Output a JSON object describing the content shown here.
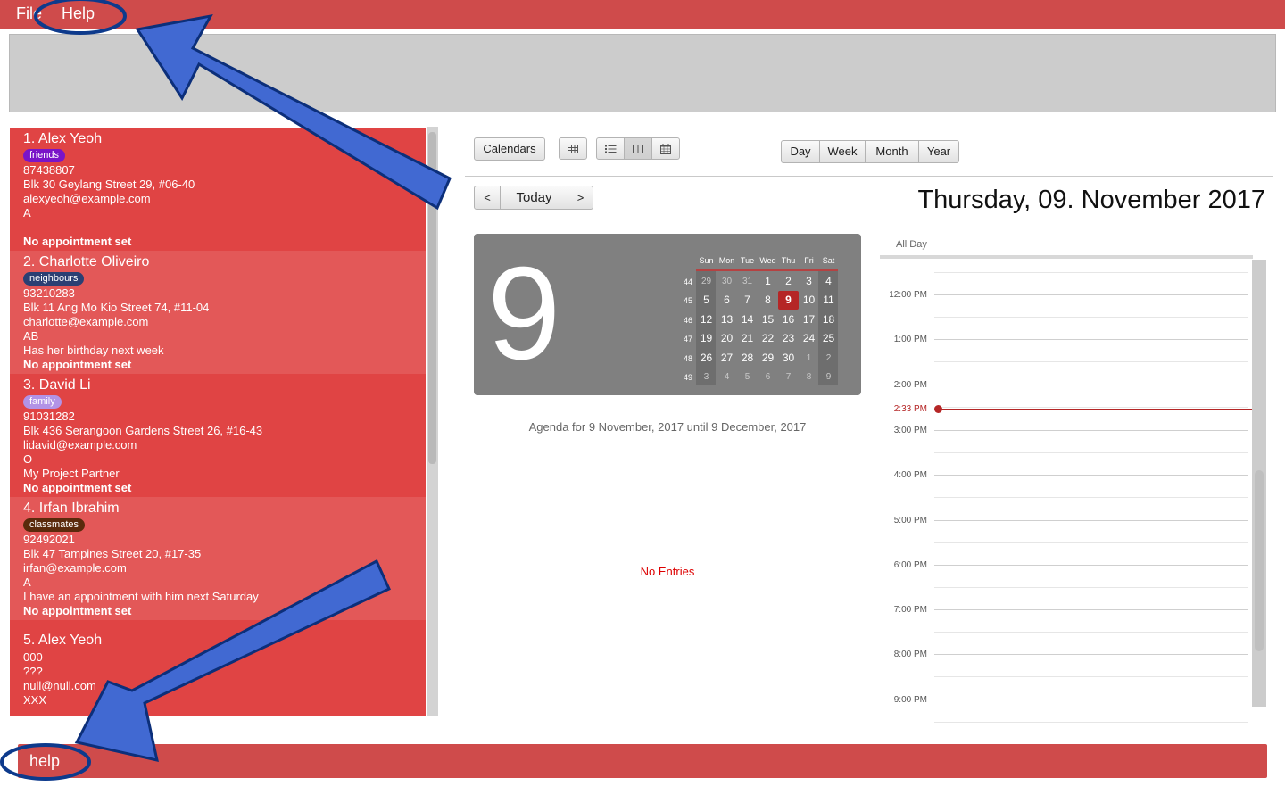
{
  "menu": {
    "file": "File",
    "help": "Help"
  },
  "persons": [
    {
      "title": "1.  Alex Yeoh",
      "tag": "friends",
      "tag_color": "#7a14c8",
      "lines": [
        "87438807",
        "Blk 30 Geylang Street 29, #06-40",
        "alexyeoh@example.com",
        "A",
        ""
      ],
      "appointment": "No appointment set"
    },
    {
      "title": "2.  Charlotte Oliveiro",
      "tag": "neighbours",
      "tag_color": "#2b3f73",
      "lines": [
        "93210283",
        "Blk 11 Ang Mo Kio Street 74, #11-04",
        "charlotte@example.com",
        "AB",
        "Has her birthday next week"
      ],
      "appointment": "No appointment set"
    },
    {
      "title": "3.  David Li",
      "tag": "family",
      "tag_color": "#b293e6",
      "lines": [
        "91031282",
        "Blk 436 Serangoon Gardens Street 26, #16-43",
        "lidavid@example.com",
        "O",
        "My Project Partner"
      ],
      "appointment": "No appointment set"
    },
    {
      "title": "4.  Irfan Ibrahim",
      "tag": "classmates",
      "tag_color": "#5a2a0c",
      "lines": [
        "92492021",
        "Blk 47 Tampines Street 20, #17-35",
        "irfan@example.com",
        "A",
        "I have an appointment with him next Saturday"
      ],
      "appointment": "No appointment set"
    },
    {
      "title": "5.  Alex Yeoh",
      "tag": "",
      "tag_color": "",
      "lines": [
        "000",
        "???",
        "null@null.com",
        "XXX"
      ],
      "appointment": ""
    }
  ],
  "calendar": {
    "toolbar": {
      "calendars": "Calendars",
      "prev": "<",
      "today": "Today",
      "next": ">",
      "day": "Day",
      "week": "Week",
      "month": "Month",
      "year": "Year"
    },
    "icons": {
      "grid": "grid-icon",
      "list": "list-icon",
      "columns": "columns-icon",
      "calendar": "calendar-icon"
    },
    "date_title": "Thursday, 09. November 2017",
    "big_day": "9",
    "minical": {
      "headers": [
        "Sun",
        "Mon",
        "Tue",
        "Wed",
        "Thu",
        "Fri",
        "Sat"
      ],
      "weeks": [
        "44",
        "45",
        "46",
        "47",
        "48",
        "49"
      ],
      "rows": [
        [
          "29",
          "30",
          "31",
          "1",
          "2",
          "3",
          "4"
        ],
        [
          "5",
          "6",
          "7",
          "8",
          "9",
          "10",
          "11"
        ],
        [
          "12",
          "13",
          "14",
          "15",
          "16",
          "17",
          "18"
        ],
        [
          "19",
          "20",
          "21",
          "22",
          "23",
          "24",
          "25"
        ],
        [
          "26",
          "27",
          "28",
          "29",
          "30",
          "1",
          "2"
        ],
        [
          "3",
          "4",
          "5",
          "6",
          "7",
          "8",
          "9"
        ]
      ],
      "today": "9"
    },
    "agenda_label": "Agenda for 9 November, 2017 until 9 December, 2017",
    "no_entries": "No Entries",
    "all_day": "All Day",
    "hours": [
      "12:00 PM",
      "1:00 PM",
      "2:00 PM",
      "3:00 PM",
      "4:00 PM",
      "5:00 PM",
      "6:00 PM",
      "7:00 PM",
      "8:00 PM",
      "9:00 PM"
    ],
    "now": "2:33 PM",
    "accent": "#b52626"
  },
  "command": {
    "text": "help"
  },
  "theme": {
    "primary": "#cf4b4b",
    "annotation": "#4169d2"
  }
}
